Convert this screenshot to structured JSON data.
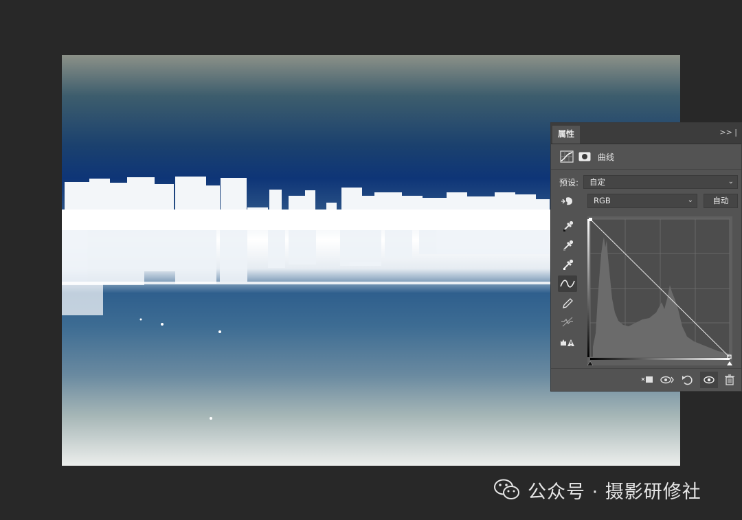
{
  "panel": {
    "tab_label": "属性",
    "collapse_label": ">>",
    "adjustment_type": "曲线",
    "preset_label": "预设:",
    "preset_value": "自定",
    "channel_value": "RGB",
    "auto_label": "自动"
  },
  "watermark": {
    "text": "公众号 · 摄影研修社"
  },
  "colors": {
    "app_background": "#282828",
    "panel_background": "#535353",
    "panel_header": "#3c3c3c",
    "sky_dark_blue": "#0e3577",
    "water_blue": "#2f5f8d"
  },
  "icons": {
    "tools": [
      "targeted-adjustment-icon",
      "sample-black-eyedropper-icon",
      "sample-gray-eyedropper-icon",
      "sample-white-eyedropper-icon",
      "curve-point-icon",
      "pencil-icon",
      "smooth-curve-icon",
      "clipping-warning-icon"
    ],
    "footer": [
      "clip-to-layer-icon",
      "view-previous-icon",
      "reset-icon",
      "visibility-icon",
      "delete-icon"
    ]
  }
}
